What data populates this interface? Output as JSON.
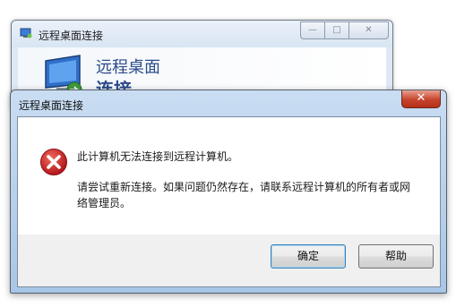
{
  "background_window": {
    "title": "远程桌面连接",
    "heading_line1": "远程桌面",
    "heading_line2": "连接",
    "icons": [
      "minimize-icon",
      "maximize-icon",
      "close-icon"
    ]
  },
  "dialog": {
    "title": "远程桌面连接",
    "message_primary": "此计算机无法连接到远程计算机。",
    "message_secondary": "请尝试重新连接。如果问题仍然存在，请联系远程计算机的所有者或网络管理员。",
    "buttons": {
      "ok": "确定",
      "help": "帮助"
    },
    "icon": "error-icon",
    "close_icon": "close-icon"
  },
  "colors": {
    "heading_blue": "#2c4b8a",
    "error_red": "#c8282a",
    "close_red": "#c7442c",
    "titlebar_blue": "#b8d2ee"
  }
}
